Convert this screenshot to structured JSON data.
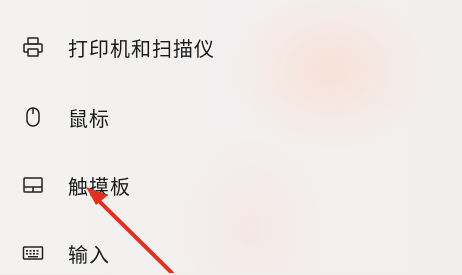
{
  "menu": {
    "items": [
      {
        "label": "打印机和扫描仪",
        "icon": "printer-icon"
      },
      {
        "label": "鼠标",
        "icon": "mouse-icon"
      },
      {
        "label": "触摸板",
        "icon": "touchpad-icon"
      },
      {
        "label": "输入",
        "icon": "keyboard-icon"
      }
    ]
  },
  "annotation": {
    "arrow_color": "#e0311f",
    "points_to": "触摸板"
  }
}
